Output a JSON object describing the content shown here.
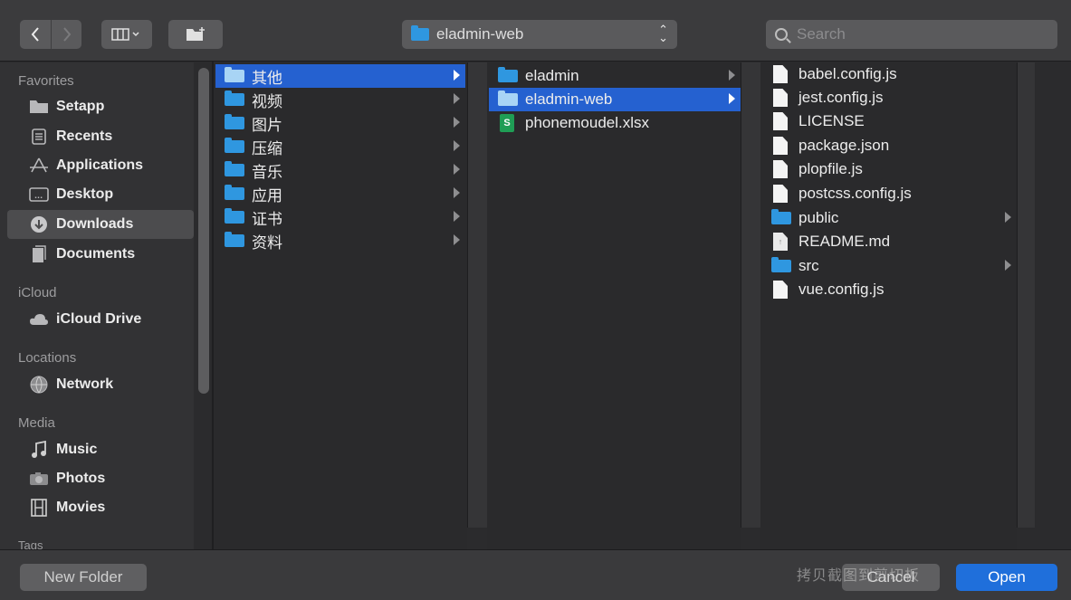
{
  "toolbar": {
    "back_icon": "chevron-left-icon",
    "forward_icon": "chevron-right-icon",
    "view_icon": "columns-view-icon",
    "new_folder_icon": "new-folder-icon",
    "path_label": "eladmin-web",
    "search_placeholder": "Search"
  },
  "sidebar": {
    "favorites_heading": "Favorites",
    "favorites": [
      {
        "label": "Setapp",
        "icon": "folder-icon"
      },
      {
        "label": "Recents",
        "icon": "recents-icon"
      },
      {
        "label": "Applications",
        "icon": "applications-icon"
      },
      {
        "label": "Desktop",
        "icon": "desktop-icon"
      },
      {
        "label": "Downloads",
        "icon": "downloads-icon"
      },
      {
        "label": "Documents",
        "icon": "documents-icon"
      }
    ],
    "icloud_heading": "iCloud",
    "icloud": [
      {
        "label": "iCloud Drive",
        "icon": "cloud-icon"
      }
    ],
    "locations_heading": "Locations",
    "locations": [
      {
        "label": "Network",
        "icon": "network-icon"
      }
    ],
    "media_heading": "Media",
    "media": [
      {
        "label": "Music",
        "icon": "music-icon"
      },
      {
        "label": "Photos",
        "icon": "camera-icon"
      },
      {
        "label": "Movies",
        "icon": "film-icon"
      }
    ],
    "tags_heading": "Tags"
  },
  "columns": {
    "col1": [
      "其他",
      "视频",
      "图片",
      "压缩",
      "音乐",
      "应用",
      "证书",
      "资料"
    ],
    "col2": [
      {
        "label": "eladmin",
        "type": "folder"
      },
      {
        "label": "eladmin-web",
        "type": "folder"
      },
      {
        "label": "phonemoudel.xlsx",
        "type": "xlsx"
      }
    ],
    "col3": [
      {
        "label": "babel.config.js",
        "type": "file"
      },
      {
        "label": "jest.config.js",
        "type": "file"
      },
      {
        "label": "LICENSE",
        "type": "file"
      },
      {
        "label": "package.json",
        "type": "file"
      },
      {
        "label": "plopfile.js",
        "type": "file"
      },
      {
        "label": "postcss.config.js",
        "type": "file"
      },
      {
        "label": "public",
        "type": "folder"
      },
      {
        "label": "README.md",
        "type": "md"
      },
      {
        "label": "src",
        "type": "folder"
      },
      {
        "label": "vue.config.js",
        "type": "file"
      }
    ]
  },
  "footer": {
    "new_folder_label": "New Folder",
    "cancel_label": "Cancel",
    "open_label": "Open",
    "overlay_text": "拷贝截图到剪切板"
  },
  "colors": {
    "selection": "#2561d0",
    "folder": "#2f97e0",
    "open_button": "#1f6fdb"
  }
}
